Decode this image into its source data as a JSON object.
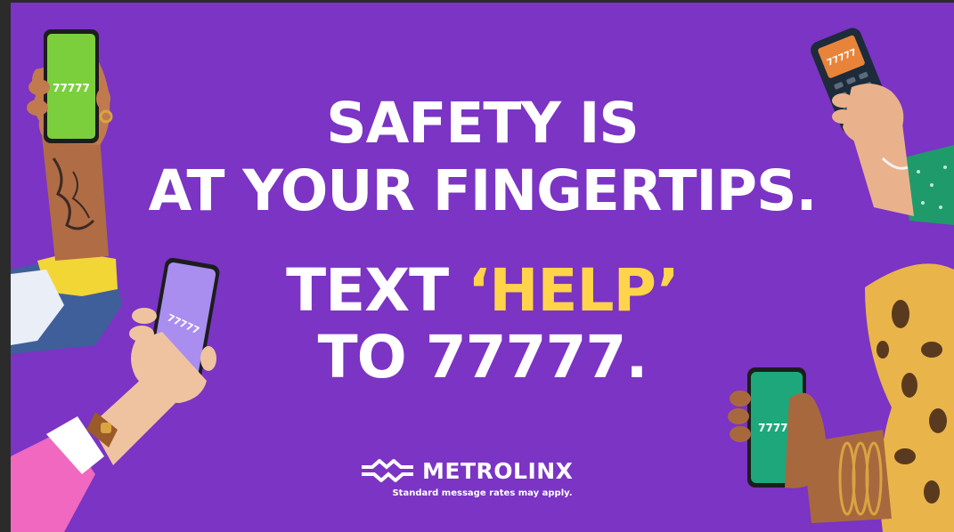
{
  "headline": {
    "line1": "SAFETY IS",
    "line2": "AT YOUR FINGERTIPS.",
    "line3_prefix": "TEXT ",
    "line3_highlight": "‘HELP’",
    "line4": "TO 77777."
  },
  "brand": {
    "name": "METROLINX",
    "disclaimer": "Standard message rates may apply."
  },
  "phones": {
    "number": "77777",
    "screen_colors": [
      "#7ccf3c",
      "#e8843a",
      "#a98ef0",
      "#1ea77a"
    ]
  },
  "colors": {
    "background": "#7b34c4",
    "text": "#ffffff",
    "highlight": "#ffd44a"
  }
}
